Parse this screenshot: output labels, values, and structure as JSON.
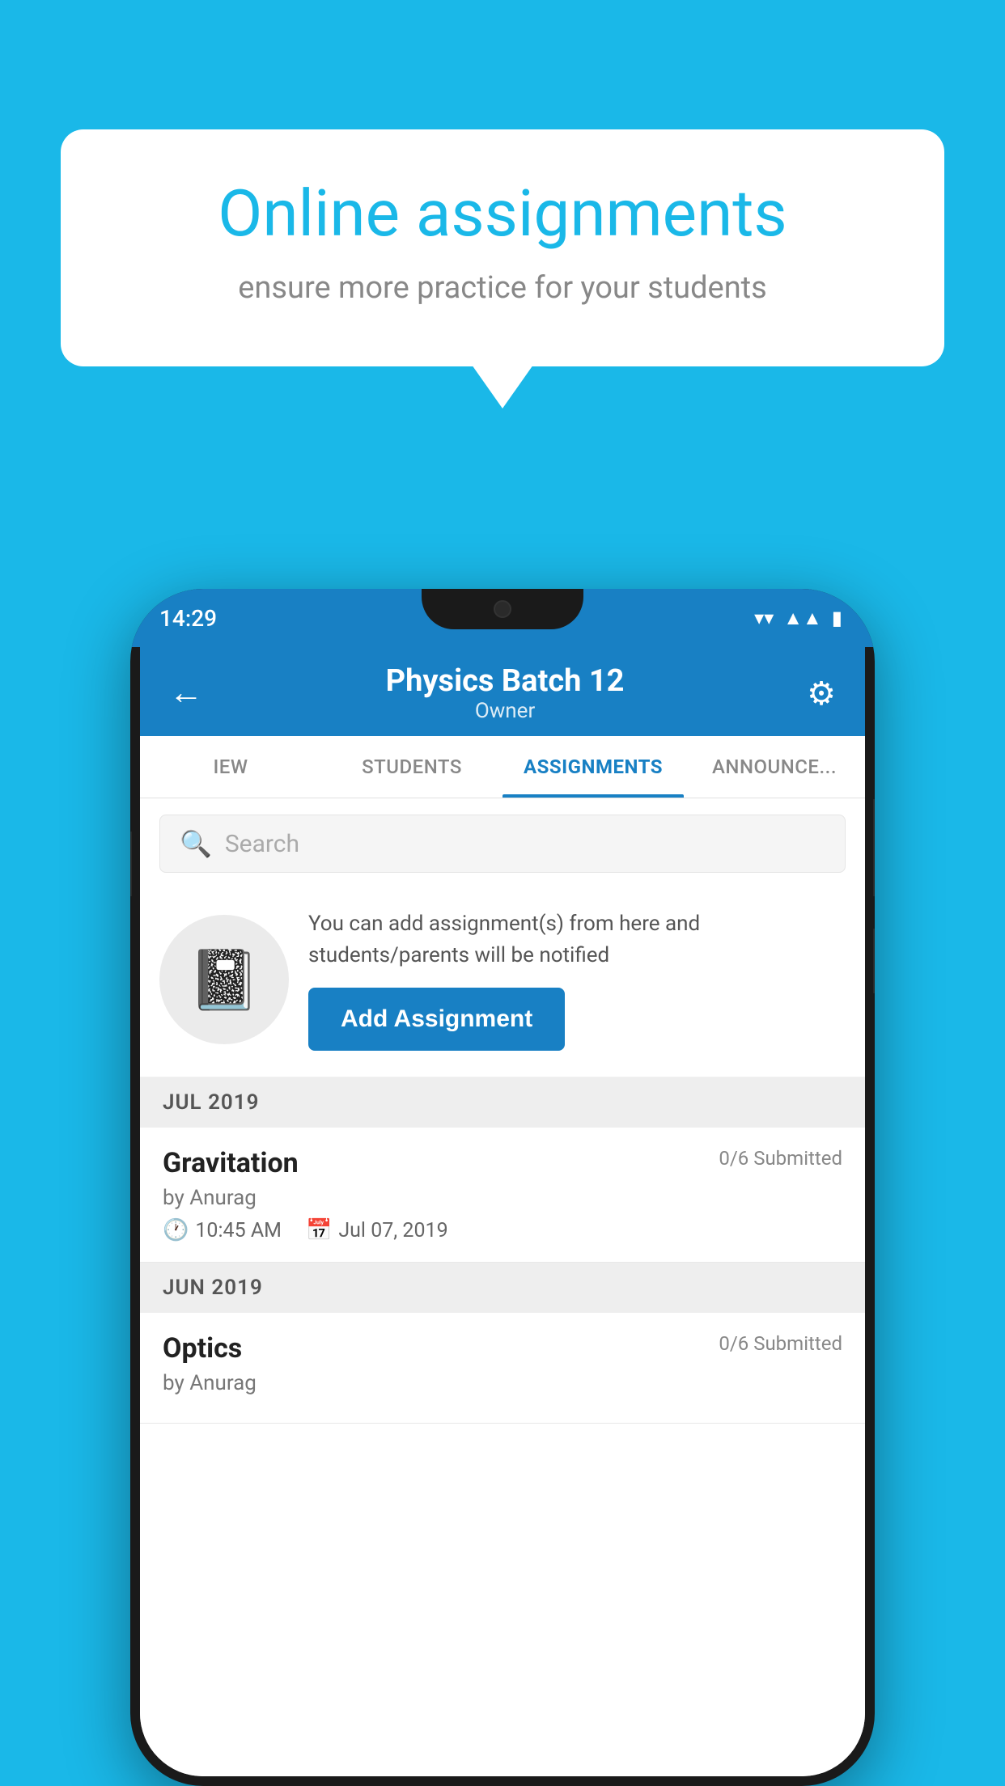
{
  "background_color": "#1ab8e8",
  "promo": {
    "title": "Online assignments",
    "subtitle": "ensure more practice for your students"
  },
  "status_bar": {
    "time": "14:29",
    "wifi_icon": "▾",
    "signal_icon": "▲",
    "battery_icon": "▮"
  },
  "header": {
    "title": "Physics Batch 12",
    "subtitle": "Owner",
    "back_label": "←",
    "settings_label": "⚙"
  },
  "tabs": [
    {
      "label": "IEW",
      "active": false
    },
    {
      "label": "STUDENTS",
      "active": false
    },
    {
      "label": "ASSIGNMENTS",
      "active": true
    },
    {
      "label": "ANNOUNCEMENTS",
      "active": false
    }
  ],
  "search": {
    "placeholder": "Search"
  },
  "add_assignment_block": {
    "description": "You can add assignment(s) from here and students/parents will be notified",
    "button_label": "Add Assignment"
  },
  "assignment_sections": [
    {
      "month": "JUL 2019",
      "assignments": [
        {
          "name": "Gravitation",
          "submitted": "0/6 Submitted",
          "by": "by Anurag",
          "time": "10:45 AM",
          "date": "Jul 07, 2019"
        }
      ]
    },
    {
      "month": "JUN 2019",
      "assignments": [
        {
          "name": "Optics",
          "submitted": "0/6 Submitted",
          "by": "by Anurag",
          "time": "",
          "date": ""
        }
      ]
    }
  ]
}
